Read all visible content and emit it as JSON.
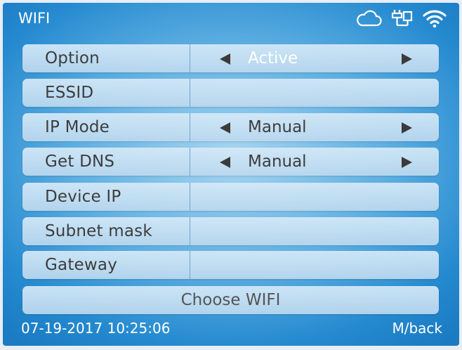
{
  "header": {
    "title": "WIFI",
    "icons": [
      "cloud-icon",
      "ethernet-icon",
      "wifi-icon"
    ]
  },
  "rows": [
    {
      "label": "Option",
      "value": "Active",
      "has_arrows": true
    },
    {
      "label": "ESSID",
      "value": "",
      "has_arrows": false
    },
    {
      "label": "IP Mode",
      "value": "Manual",
      "has_arrows": true
    },
    {
      "label": "Get DNS",
      "value": "Manual",
      "has_arrows": true
    },
    {
      "label": "Device IP",
      "value": "",
      "has_arrows": false
    },
    {
      "label": "Subnet mask",
      "value": "",
      "has_arrows": false
    },
    {
      "label": "Gateway",
      "value": "",
      "has_arrows": false
    }
  ],
  "choose_wifi_label": "Choose WIFI",
  "footer": {
    "datetime": "07-19-2017 10:25:06",
    "back_label": "M/back"
  },
  "colors": {
    "accent": "#2489cf",
    "row_text": "#3d3d3d",
    "active_value": "#ffffff"
  }
}
